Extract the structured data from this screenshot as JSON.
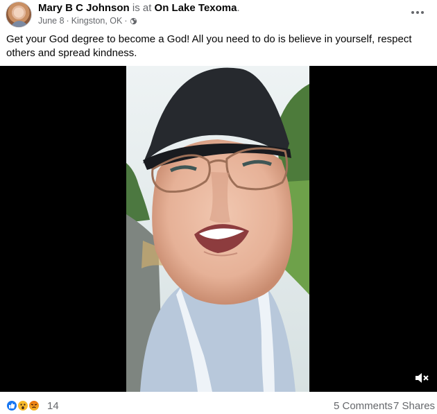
{
  "post": {
    "author": "Mary B C Johnson",
    "is_at": "is at",
    "location": "On Lake Texoma",
    "date": "June 8",
    "separator": "·",
    "place": "Kingston, OK",
    "separator2": "·",
    "privacy_icon": "globe-icon",
    "text": "Get your God degree to become a God! All you need to do is believe in yourself, respect others and spread kindness."
  },
  "video": {
    "mute_icon": "speaker-muted-icon"
  },
  "footer": {
    "reactions": [
      "like-icon",
      "wow-icon",
      "angry-icon"
    ],
    "reaction_count": "14",
    "comments": "5 Comments",
    "shares": "7 Shares"
  },
  "colors": {
    "primary_text": "#050505",
    "secondary_text": "#65676b",
    "facebook_blue": "#1877f2",
    "video_background": "#000000"
  }
}
